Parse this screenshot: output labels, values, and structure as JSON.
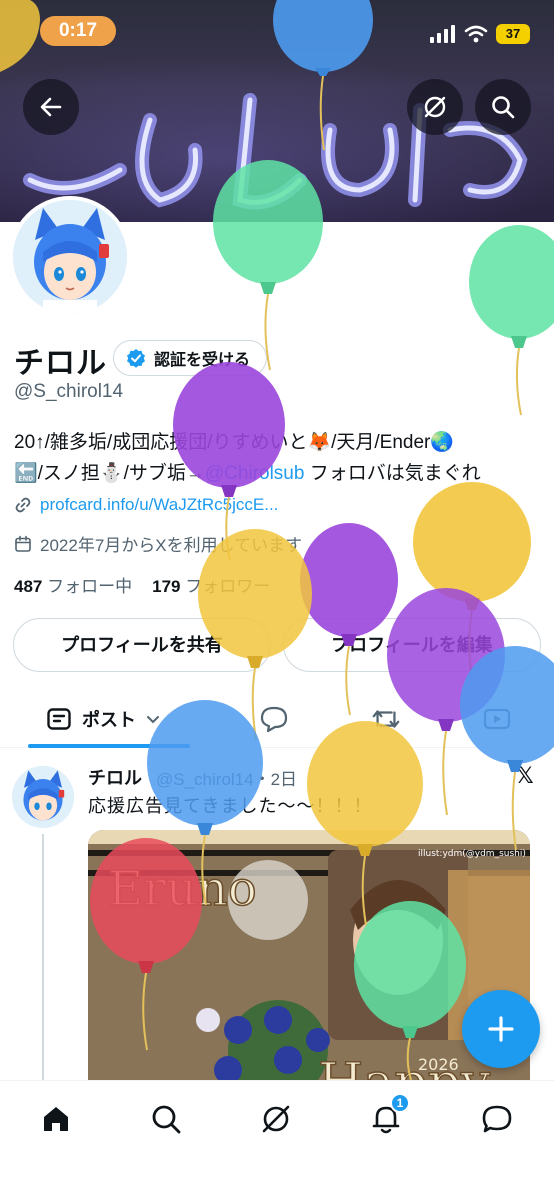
{
  "status_bar": {
    "time": "0:17",
    "battery": "37"
  },
  "profile": {
    "name": "チロル",
    "verify_button": "認証を受ける",
    "handle": "@S_chirol14",
    "bio_line1": "20↑/雑多垢/成団応援団/りすめいと🦊/天月/Ender🌏",
    "bio_line2_a": "🔚/スノ担⛄/サブ垢→",
    "bio_mention": "@Chirolsub",
    "bio_line2_b": " フォロバは気まぐれ",
    "link": "profcard.info/u/WaJZtRc5jccE...",
    "joined": "2022年7月からXを利用しています",
    "following_count": "487",
    "following_label": "フォロー中",
    "followers_count": "179",
    "followers_label": "フォロワー"
  },
  "actions": {
    "share": "プロフィールを共有",
    "edit": "プロフィールを編集"
  },
  "tabs": {
    "posts": "ポスト"
  },
  "post": {
    "author": "チロル",
    "meta": "@S_chirol14・2日",
    "text": "応援広告見てきました〜〜！！！",
    "image_text": "Eruno",
    "image_text2": "Happy",
    "image_credit": "illust:ydm(@ydm_sushi)",
    "image_year": "2026"
  },
  "notifications_badge": "1",
  "colors": {
    "accent": "#1d9bf0",
    "status_time_pill": "#f0a24a",
    "battery": "#f4d000"
  },
  "icons": [
    "back-arrow-icon",
    "grok-icon",
    "search-icon",
    "verified-badge-icon",
    "link-icon",
    "calendar-icon",
    "posts-tab-icon",
    "chevron-down-icon",
    "replies-icon",
    "repost-icon",
    "media-icon",
    "x-logo-icon",
    "compose-plus-icon",
    "home-icon",
    "nav-search-icon",
    "nav-grok-icon",
    "bell-icon",
    "messages-icon"
  ]
}
